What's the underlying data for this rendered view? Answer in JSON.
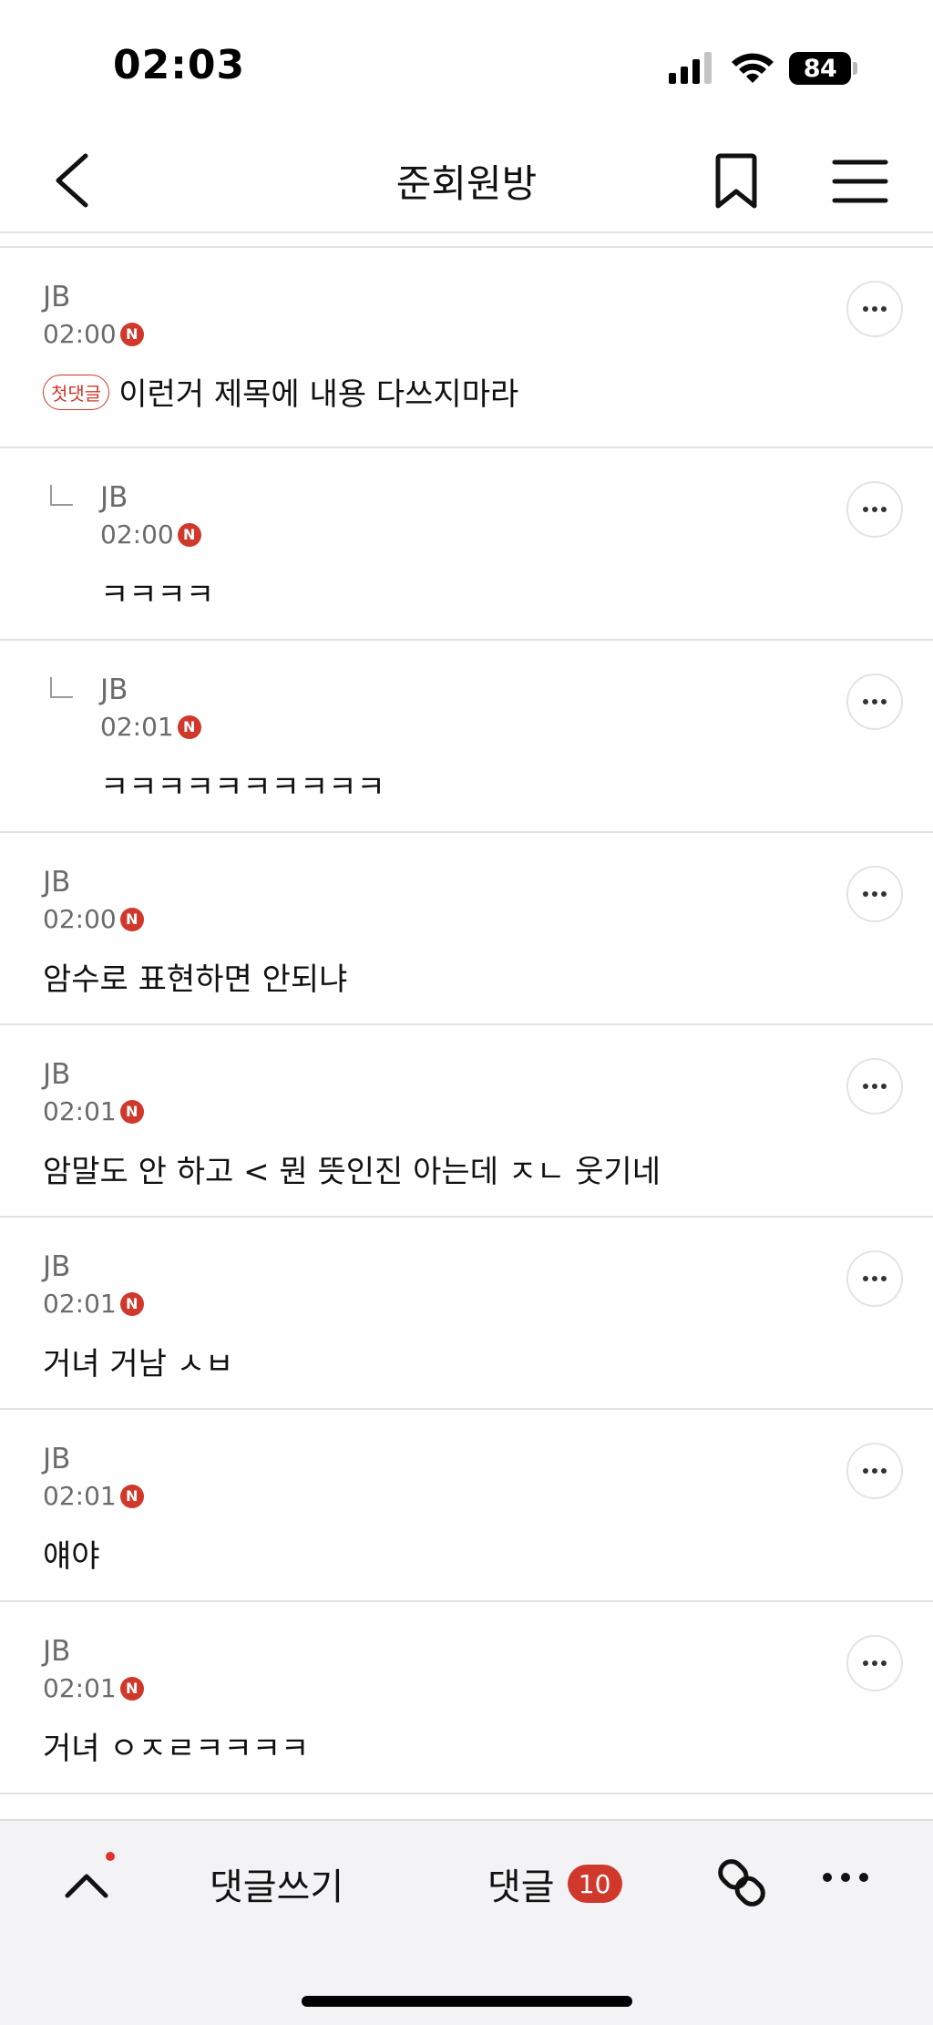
{
  "status_bar": {
    "time": "02:03",
    "battery": "84"
  },
  "header": {
    "title": "준회원방",
    "icons": [
      "back-icon",
      "bookmark-icon",
      "menu-icon"
    ]
  },
  "comments": [
    {
      "author": "JB",
      "time": "02:00",
      "new_badge": "N",
      "first_badge": "첫댓글",
      "body": "이런거 제목에 내용 다쓰지마라",
      "reply": false
    },
    {
      "author": "JB",
      "time": "02:00",
      "new_badge": "N",
      "body": "ㅋㅋㅋㅋ",
      "reply": true
    },
    {
      "author": "JB",
      "time": "02:01",
      "new_badge": "N",
      "body": "ㅋㅋㅋㅋㅋㅋㅋㅋㅋㅋ",
      "reply": true
    },
    {
      "author": "JB",
      "time": "02:00",
      "new_badge": "N",
      "body": "암수로 표현하면 안되냐",
      "reply": false
    },
    {
      "author": "JB",
      "time": "02:01",
      "new_badge": "N",
      "body": "암말도 안 하고 < 뭔 뜻인진 아는데 ㅈㄴ 웃기네",
      "reply": false
    },
    {
      "author": "JB",
      "time": "02:01",
      "new_badge": "N",
      "body": "거녀 거남 ㅅㅂ",
      "reply": false
    },
    {
      "author": "JB",
      "time": "02:01",
      "new_badge": "N",
      "body": "얘야",
      "reply": false
    },
    {
      "author": "JB",
      "time": "02:01",
      "new_badge": "N",
      "body": "거녀 ㅇㅈㄹㅋㅋㅋㅋ",
      "reply": false
    }
  ],
  "bottom_bar": {
    "write_comment": "댓글쓰기",
    "comments_label": "댓글",
    "comments_count": "10",
    "icons": [
      "scroll-top-icon",
      "link-icon",
      "more-icon"
    ]
  },
  "colors": {
    "accent_red": "#d0382c",
    "meta_gray": "#6b6b6b",
    "divider": "#e2e2e2",
    "bottom_bar_bg": "#f3f3f5"
  }
}
